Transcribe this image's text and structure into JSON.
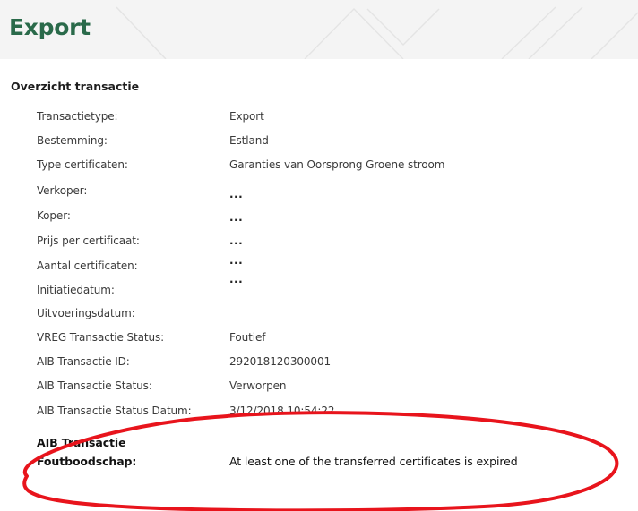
{
  "header": {
    "title": "Export"
  },
  "section": {
    "title": "Overzicht transactie"
  },
  "details": {
    "rows": [
      {
        "label": "Transactietype:",
        "value": "Export"
      },
      {
        "label": "Bestemming:",
        "value": "Estland"
      },
      {
        "label": "Type certificaten:",
        "value": "Garanties van Oorsprong Groene stroom"
      },
      {
        "label": "Verkoper:",
        "value": "..."
      },
      {
        "label": "Koper:",
        "value": "..."
      },
      {
        "label": "Prijs per certificaat:",
        "value": "..."
      },
      {
        "label": "Aantal certificaten:",
        "value": "..."
      },
      {
        "label": "Initiatiedatum:",
        "value": "..."
      },
      {
        "label": "Uitvoeringsdatum:",
        "value": ""
      },
      {
        "label": "VREG Transactie Status:",
        "value": "Foutief"
      },
      {
        "label": "AIB Transactie ID:",
        "value": "292018120300001"
      },
      {
        "label": "AIB Transactie Status:",
        "value": "Verworpen"
      },
      {
        "label": "AIB Transactie Status Datum:",
        "value": "3/12/2018 10:54:22"
      }
    ],
    "error_row": {
      "label_line1": "AIB Transactie",
      "label_line2": "Foutboodschap:",
      "value": "At least one of the transferred certificates is expired"
    }
  },
  "annotation": {
    "highlight_color": "#e8141c"
  },
  "colors": {
    "title_green": "#2a6a4a",
    "header_background": "#f4f4f4"
  }
}
